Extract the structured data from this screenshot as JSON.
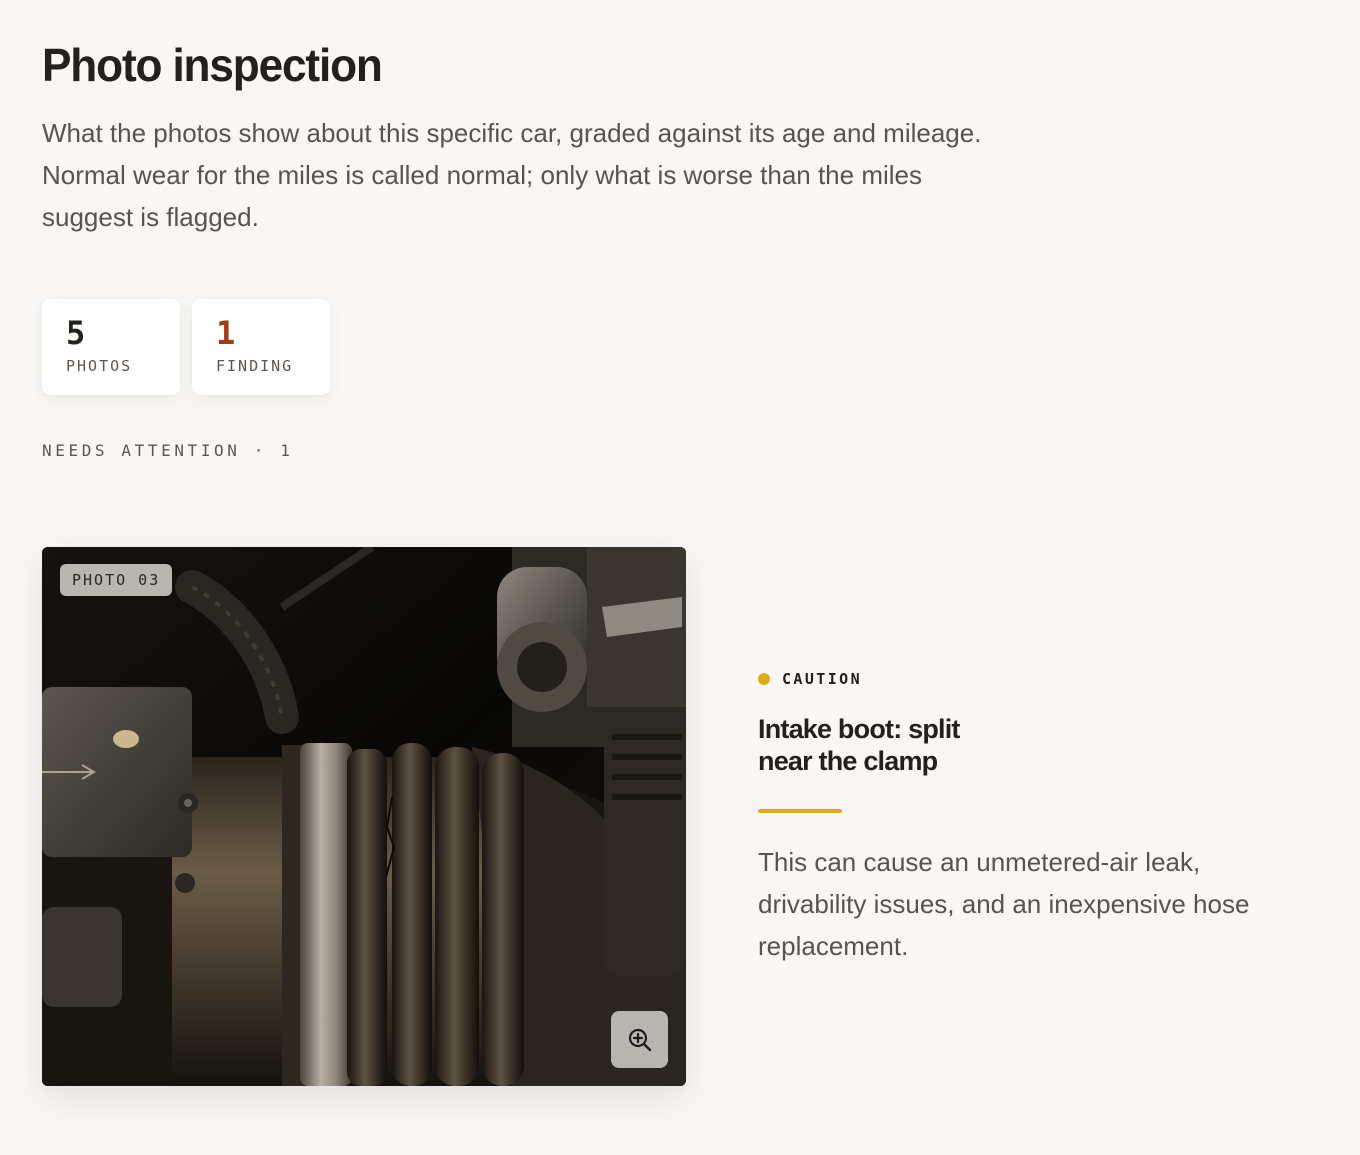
{
  "header": {
    "title": "Photo inspection",
    "intro_lines": [
      "What the photos show about this specific car, graded against its age and mileage.",
      "Normal wear for the miles is called normal; only what is worse than the miles",
      "suggest is flagged."
    ]
  },
  "stats": {
    "photos": {
      "value": "5",
      "label": "PHOTOS"
    },
    "findings": {
      "value": "1",
      "label": "FINDING",
      "color": "#a23a13"
    }
  },
  "section": {
    "label": "NEEDS ATTENTION · 1"
  },
  "finding": {
    "photo_tag": "PHOTO 03",
    "zoom_icon": "zoom-in-icon",
    "severity": "CAUTION",
    "severity_color": "#e1ac12",
    "title": "Intake boot: split near the clamp",
    "body": "This can cause an unmetered-air leak, drivability issues, and an inexpensive hose replacement."
  }
}
